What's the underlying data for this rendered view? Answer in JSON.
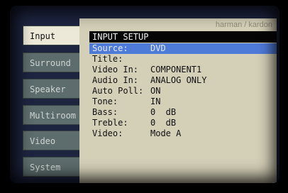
{
  "brand": "harman / kardon",
  "tabs": [
    {
      "label": "Input",
      "active": true
    },
    {
      "label": "Surround",
      "active": false
    },
    {
      "label": "Speaker",
      "active": false
    },
    {
      "label": "Multiroom",
      "active": false
    },
    {
      "label": "Video",
      "active": false
    },
    {
      "label": "System",
      "active": false
    }
  ],
  "panel": {
    "title": "INPUT SETUP",
    "rows": [
      {
        "label": "Source:",
        "value": "DVD",
        "selected": true
      },
      {
        "label": "Title:",
        "value": ""
      },
      {
        "label": "Video In:",
        "value": "COMPONENT1"
      },
      {
        "label": "Audio In:",
        "value": "ANALOG ONLY"
      },
      {
        "label": "Auto Poll:",
        "value": "ON"
      },
      {
        "label": "Tone:",
        "value": "IN"
      },
      {
        "label": "Bass:",
        "value": "0  dB"
      },
      {
        "label": "Treble:",
        "value": "0  dB"
      },
      {
        "label": "Video:",
        "value": "Mode A"
      }
    ]
  },
  "colors": {
    "screen_bg": "#1d2440",
    "panel_bg": "#d4cfb7",
    "tab_bg": "#5d6c6c",
    "tab_active_bg": "#ece9d8",
    "selection": "#4f7bd8"
  }
}
